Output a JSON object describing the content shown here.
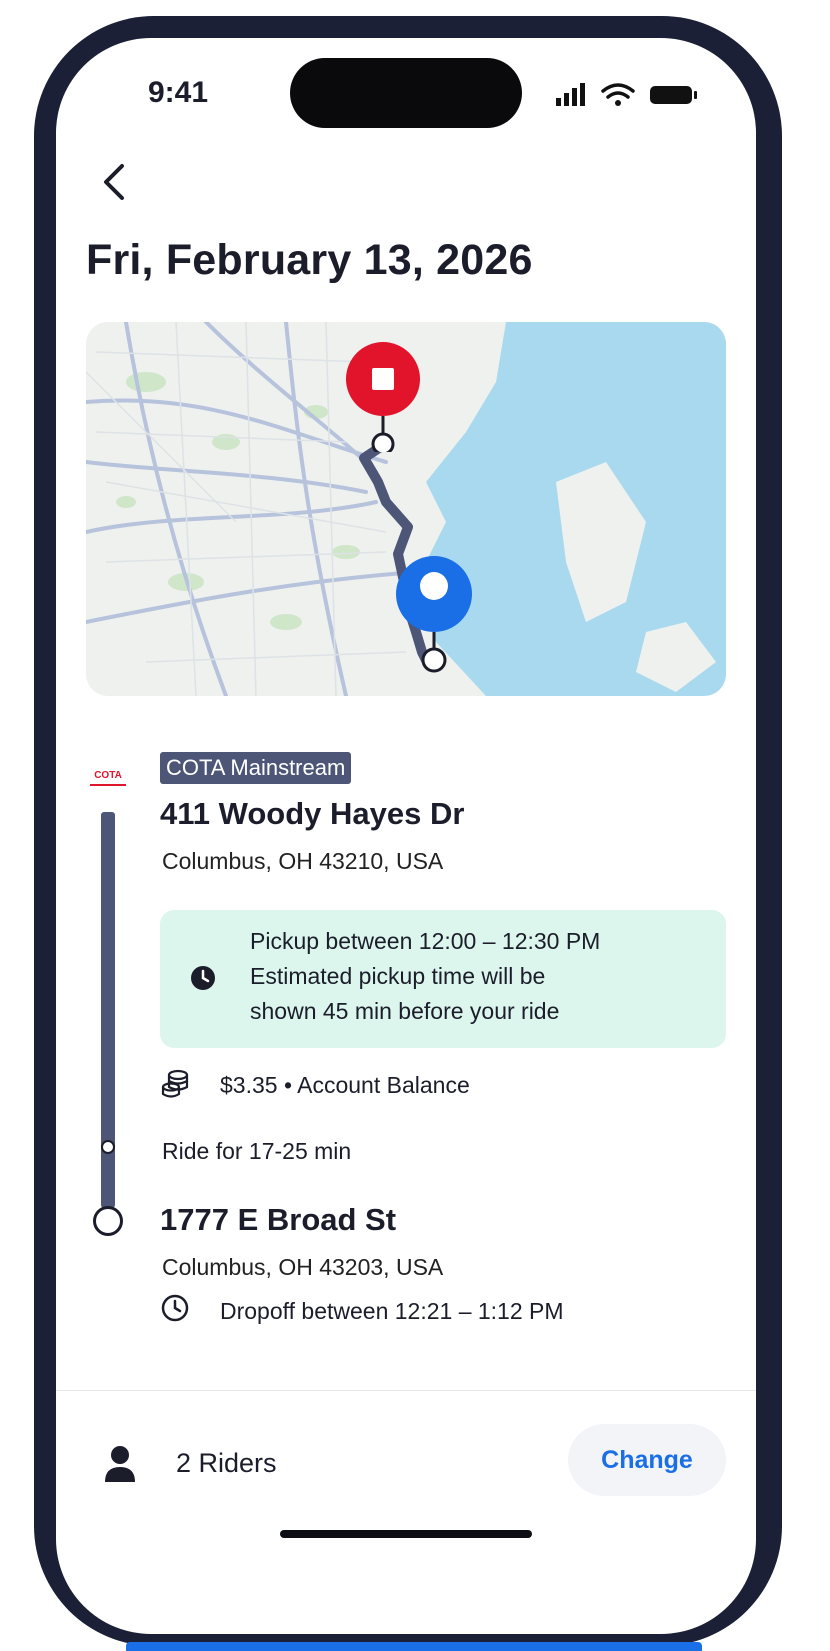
{
  "status_bar": {
    "time": "9:41"
  },
  "header": {
    "title": "Fri, February 13, 2026"
  },
  "map": {
    "colors": {
      "water": "#a9d9ee",
      "land": "#eef1ee",
      "route": "#4d5677",
      "dropoff_pin": "#e1142c",
      "pickup_pin": "#1a6fe6"
    }
  },
  "ride": {
    "agency_logo_text": "COTA",
    "service_tag": "COTA Mainstream",
    "pickup": {
      "address": "411 Woody Hayes Dr",
      "city": "Columbus, OH 43210, USA",
      "window": "Pickup between 12:00 – 12:30 PM",
      "note_line1": "Estimated pickup time will be",
      "note_line2": "shown 45 min before your ride"
    },
    "fare": "$3.35 • Account Balance",
    "duration": "Ride for 17-25 min",
    "dropoff": {
      "address": "1777 E Broad St",
      "city": "Columbus, OH 43203, USA",
      "window": "Dropoff between 12:21 – 1:12 PM"
    }
  },
  "footer": {
    "riders": "2 Riders",
    "change_label": "Change"
  }
}
